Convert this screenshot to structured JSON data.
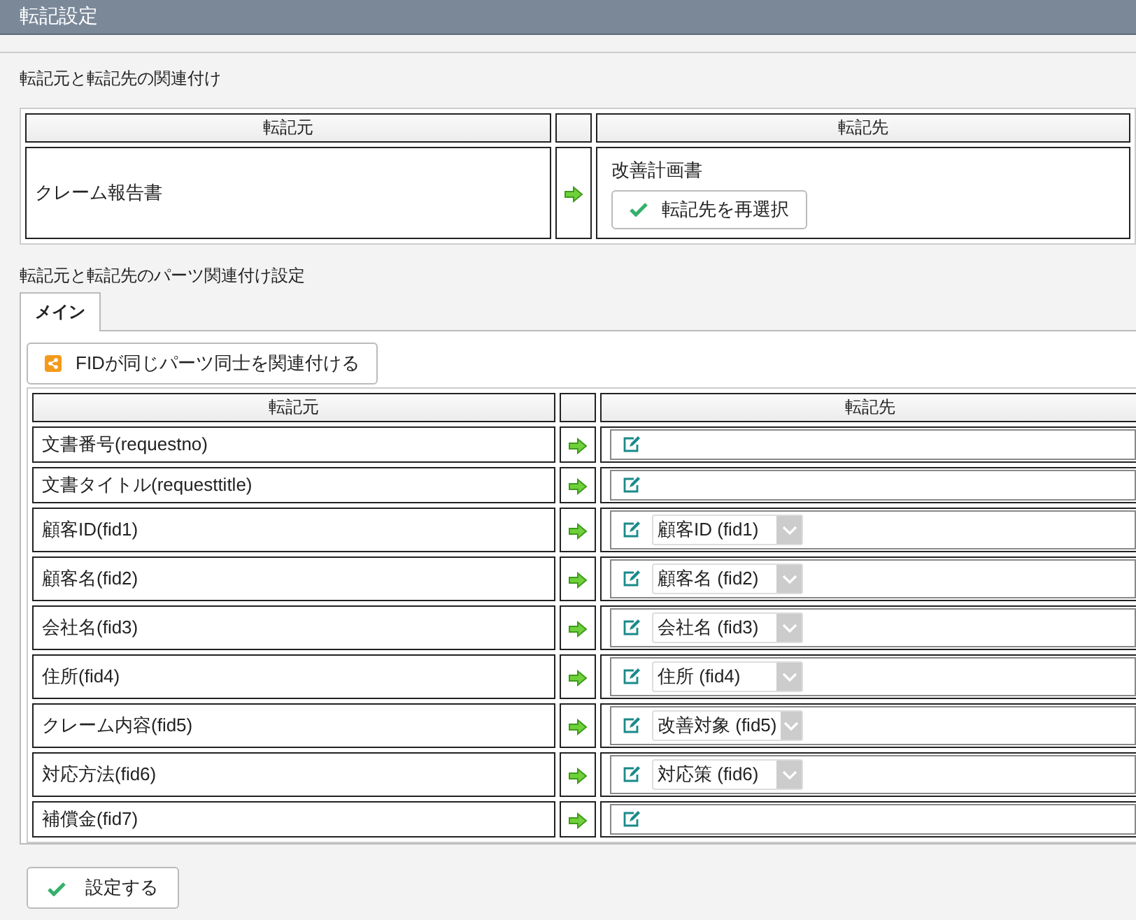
{
  "header": {
    "title": "転記設定"
  },
  "association": {
    "heading": "転記元と転記先の関連付け",
    "source_column": "転記元",
    "target_column": "転記先",
    "source": "クレーム報告書",
    "target": "改善計画書",
    "reselect_button": "転記先を再選択"
  },
  "parts": {
    "heading": "転記元と転記先のパーツ関連付け設定",
    "tabs": [
      {
        "label": "メイン",
        "selected": true
      }
    ],
    "auto_link_button": "FIDが同じパーツ同士を関連付ける",
    "source_column": "転記元",
    "target_column": "転記先",
    "rows": [
      {
        "source": "文書番号(requestno)"
      },
      {
        "source": "文書タイトル(requesttitle)"
      },
      {
        "source": "顧客ID(fid1)",
        "target": "顧客ID (fid1)"
      },
      {
        "source": "顧客名(fid2)",
        "target": "顧客名 (fid2)"
      },
      {
        "source": "会社名(fid3)",
        "target": "会社名 (fid3)"
      },
      {
        "source": "住所(fid4)",
        "target": "住所 (fid4)"
      },
      {
        "source": "クレーム内容(fid5)",
        "target": "改善対象 (fid5)"
      },
      {
        "source": "対応方法(fid6)",
        "target": "対応策 (fid6)"
      },
      {
        "source": "補償金(fid7)"
      }
    ]
  },
  "save_button": "設定する"
}
